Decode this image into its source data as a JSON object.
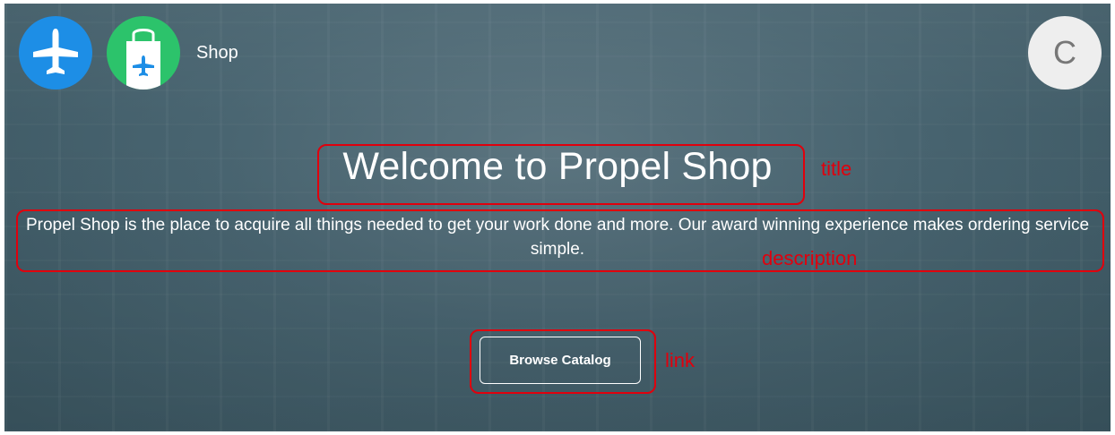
{
  "header": {
    "app_label": "Shop",
    "avatar_initial": "C",
    "icons": [
      "airplane-icon",
      "shopping-bag-icon"
    ]
  },
  "hero": {
    "title": "Welcome to Propel Shop",
    "description": "Propel Shop is the place to acquire all things needed to get your work done and more. Our award winning experience makes ordering service simple.",
    "cta_label": "Browse Catalog"
  },
  "annotations": {
    "title_label": "title",
    "description_label": "description",
    "link_label": "link",
    "color": "#e0000d"
  },
  "colors": {
    "app_icon_1": "#1d8ee6",
    "app_icon_2": "#2cc36b",
    "hero_overlay": "#486470"
  }
}
